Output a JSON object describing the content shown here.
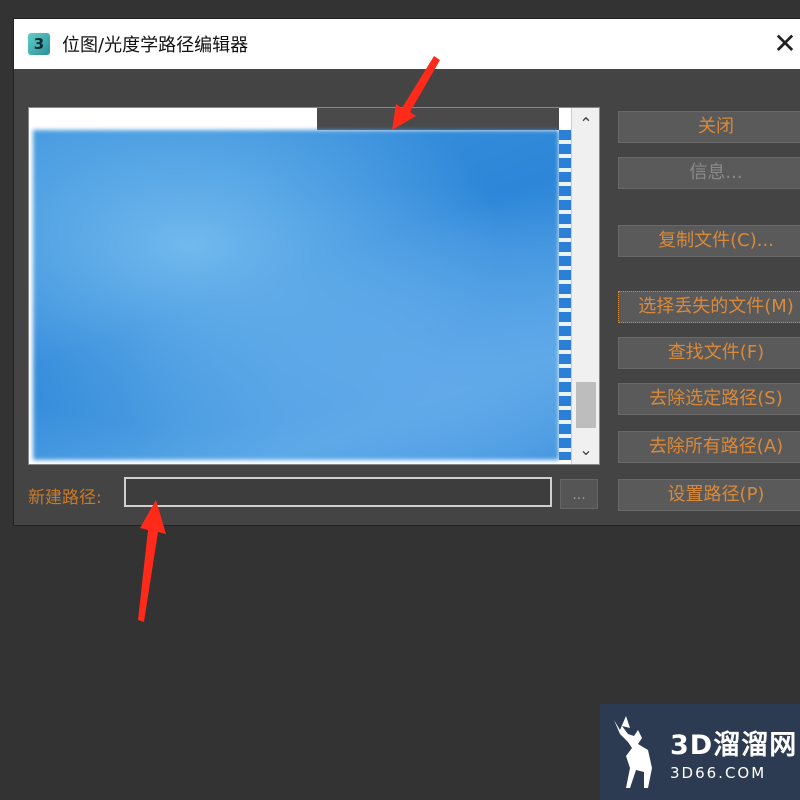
{
  "window": {
    "title": "位图/光度学路径编辑器",
    "app_icon_label": "3",
    "close_glyph": "✕"
  },
  "list": {
    "scroll_up_glyph": "⌃",
    "scroll_down_glyph": "⌄"
  },
  "new_path": {
    "label": "新建路径:",
    "value": "",
    "browse_label": "..."
  },
  "buttons": {
    "close": "关闭",
    "info": "信息...",
    "copy_files": "复制文件(C)...",
    "select_missing": "选择丢失的文件(M)",
    "find_files": "查找文件(F)",
    "strip_selected": "去除选定路径(S)",
    "strip_all": "去除所有路径(A)",
    "set_path": "设置路径(P)"
  },
  "watermark": {
    "main": "3D溜溜网",
    "sub": "3D66.COM"
  },
  "colors": {
    "accent_text": "#d9893a",
    "dialog_bg": "#444444",
    "annotation_arrow": "#ff2a1a"
  }
}
